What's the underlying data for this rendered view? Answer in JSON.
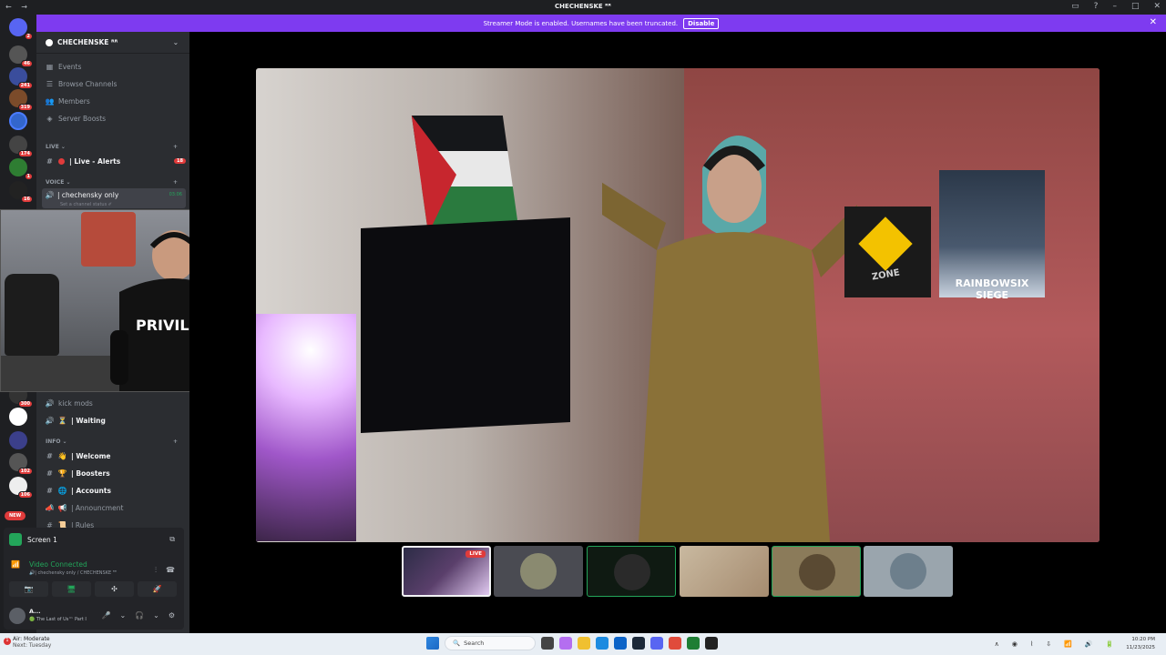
{
  "window": {
    "title": "CHECHENSKE ᴿᴿ",
    "nav_arrows": "← →",
    "controls": [
      "▭",
      "?",
      "–",
      "□",
      "✕"
    ]
  },
  "banner": {
    "message": "Streamer Mode is enabled. Usernames have been truncated.",
    "disable_label": "Disable",
    "close": "✕"
  },
  "rail": {
    "badges": [
      "2",
      "46",
      "241",
      "319",
      "",
      "174",
      "1",
      "16",
      "300",
      "",
      "",
      "102",
      "106"
    ],
    "new_label": "NEW"
  },
  "sidebar": {
    "guild_name": "CHECHENSKE ᴿᴿ",
    "guild_chevron": "⌄",
    "nav": [
      {
        "label": "Events",
        "icon": "calendar-icon",
        "glyph": "▦"
      },
      {
        "label": "Browse Channels",
        "icon": "browse-icon",
        "glyph": "☰"
      },
      {
        "label": "Members",
        "icon": "members-icon",
        "glyph": "👥"
      },
      {
        "label": "Server Boosts",
        "icon": "boost-icon",
        "glyph": "◈"
      }
    ],
    "cat_live": "LIVE ⌄",
    "live_channel": {
      "label": "| Live - Alerts",
      "badge": "18",
      "hash": "#"
    },
    "cat_voice": "VOICE ⌄",
    "voice_channel": {
      "label": "| chechensky only",
      "time": "03:06",
      "status": "Set a channel status ✐"
    },
    "lower_channels": [
      {
        "label": "kick mods",
        "glyph": "🔊"
      },
      {
        "label": "| Waiting",
        "glyph": "🔊",
        "emoji": "⏳"
      }
    ],
    "cat_info": "INFO ⌄",
    "info_channels": [
      {
        "label": "| Welcome",
        "emoji": "👋",
        "hash": "#"
      },
      {
        "label": "| Boosters",
        "emoji": "🏆",
        "hash": "#"
      },
      {
        "label": "| Accounts",
        "emoji": "🌐",
        "hash": "#"
      },
      {
        "label": "| Announcment",
        "emoji": "📢",
        "hash": "📣"
      },
      {
        "label": "| Rules",
        "emoji": "📜",
        "hash": "#"
      }
    ],
    "plus": "+"
  },
  "popout": {
    "shirt_text": "PRIVILEGE"
  },
  "panel": {
    "screen_label": "Screen 1",
    "popout_glyph": "⧉",
    "vc_title": "Video Connected",
    "vc_sub": "🔊| chechensky only / CHECHENSKE ᴿᴿ",
    "signal_glyph": "📶",
    "vc_icons": [
      "⫶",
      "☎"
    ],
    "buttons": [
      "📷",
      "🖥",
      "✣",
      "🚀"
    ],
    "user_name": "A...",
    "user_status": "🟢 The Last of Us™ Part I",
    "user_controls": [
      "🎤",
      "⌄",
      "🎧",
      "⌄",
      "⚙"
    ]
  },
  "main_video": {
    "poster_text": "RAINBOWSIX SIEGE",
    "sign_text": "ZONE"
  },
  "tiles": {
    "live_label": "LIVE"
  },
  "taskbar": {
    "weather_badge": "1",
    "weather_line1": "Air: Moderate",
    "weather_line2": "Next: Tuesday",
    "search_label": "Search",
    "search_icon": "🔍",
    "tray": [
      "∧",
      "◉",
      "⌇",
      "⇩",
      "📶",
      "🔊",
      "🔋"
    ],
    "time": "10:20 PM",
    "date": "11/23/2025"
  },
  "colors": {
    "accent": "#7e3bf0",
    "online": "#23a55a",
    "badge": "#e03b3b"
  }
}
